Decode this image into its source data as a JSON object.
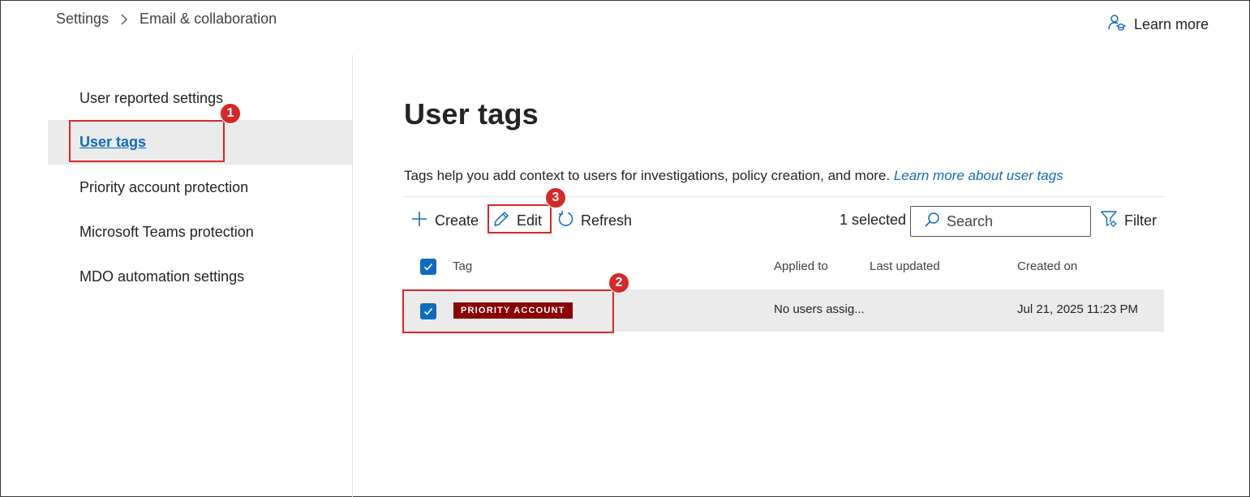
{
  "breadcrumb": {
    "root": "Settings",
    "current": "Email & collaboration"
  },
  "header": {
    "learn_more": "Learn more"
  },
  "nav": {
    "items": [
      {
        "label": "User reported settings"
      },
      {
        "label": "User tags"
      },
      {
        "label": "Priority account protection"
      },
      {
        "label": "Microsoft Teams protection"
      },
      {
        "label": "MDO automation settings"
      }
    ],
    "active_index": 1
  },
  "main": {
    "title": "User tags",
    "description": "Tags help you add context to users for investigations, policy creation, and more.",
    "description_link": "Learn more about user tags"
  },
  "toolbar": {
    "create": "Create",
    "edit": "Edit",
    "refresh": "Refresh",
    "selected": "1 selected",
    "search_placeholder": "Search",
    "filter": "Filter"
  },
  "table": {
    "columns": [
      "Tag",
      "Applied to",
      "Last updated",
      "Created on"
    ],
    "rows": [
      {
        "tag": "PRIORITY ACCOUNT",
        "applied_to": "No users assig...",
        "last_updated": "",
        "created_on": "Jul 21, 2025 11:23 PM",
        "selected": true
      }
    ]
  },
  "callouts": [
    "1",
    "2",
    "3"
  ],
  "colors": {
    "accent": "#0f6cbd",
    "tag_bg": "#8b0000",
    "callout": "#d62828",
    "selected_row": "#ebebeb"
  },
  "icons": [
    "chevron-right-icon",
    "learn-icon",
    "add-icon",
    "edit-icon",
    "refresh-icon",
    "search-icon",
    "filter-icon",
    "checkmark-icon"
  ]
}
